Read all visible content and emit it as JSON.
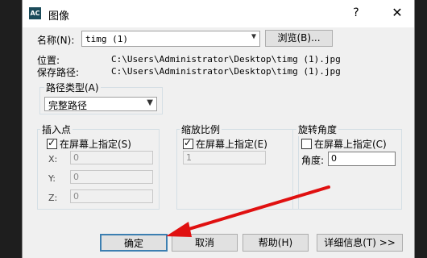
{
  "window": {
    "title": "图像",
    "help": "?",
    "close": "✕"
  },
  "name_row": {
    "label": "名称(N):",
    "value": "timg (1)",
    "browse": "浏览(B)..."
  },
  "location": {
    "label": "位置:",
    "value": "C:\\Users\\Administrator\\Desktop\\timg (1).jpg"
  },
  "save_path": {
    "label": "保存路径:",
    "value": "C:\\Users\\Administrator\\Desktop\\timg (1).jpg"
  },
  "path_type": {
    "group": "路径类型(A)",
    "selected": "完整路径"
  },
  "insertion": {
    "group": "插入点",
    "on_screen": "在屏幕上指定(S)",
    "on_screen_checked": true,
    "x_label": "X:",
    "x_value": "0",
    "y_label": "Y:",
    "y_value": "0",
    "z_label": "Z:",
    "z_value": "0"
  },
  "scale": {
    "group": "缩放比例",
    "on_screen": "在屏幕上指定(E)",
    "on_screen_checked": true,
    "value": "1"
  },
  "rotation": {
    "group": "旋转角度",
    "on_screen": "在屏幕上指定(C)",
    "on_screen_checked": false,
    "angle_label": "角度:",
    "angle_value": "0"
  },
  "buttons": {
    "ok": "确定",
    "cancel": "取消",
    "help": "帮助(H)",
    "details": "详细信息(T) >>"
  },
  "annotation": {
    "arrow_color": "#e01010"
  }
}
